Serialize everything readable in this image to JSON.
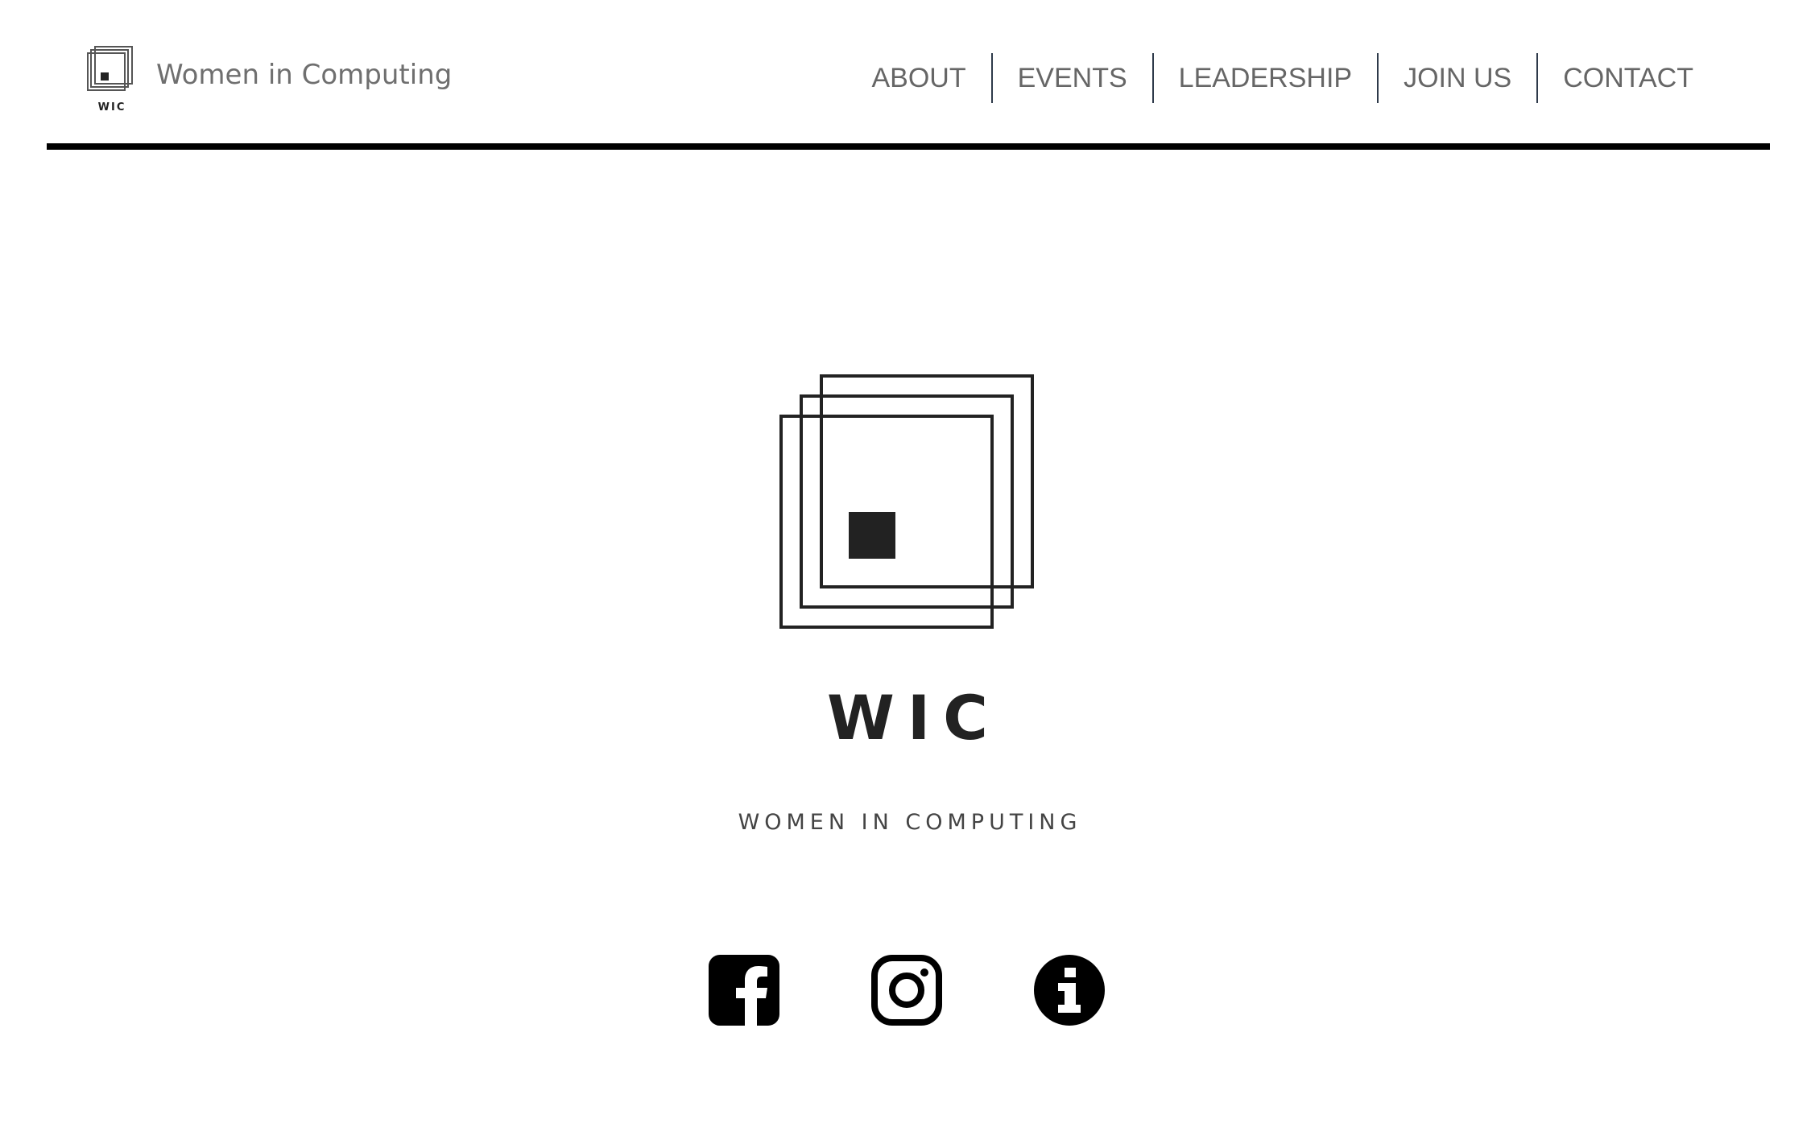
{
  "header": {
    "brand_name": "Women in Computing",
    "logo_text": "WIC",
    "nav": [
      {
        "label": "ABOUT"
      },
      {
        "label": "EVENTS"
      },
      {
        "label": "LEADERSHIP"
      },
      {
        "label": "JOIN US"
      },
      {
        "label": "CONTACT"
      }
    ]
  },
  "hero": {
    "title": "WIC",
    "subtitle": "WOMEN IN COMPUTING"
  },
  "social": [
    {
      "icon": "facebook-icon"
    },
    {
      "icon": "instagram-icon"
    },
    {
      "icon": "info-icon"
    }
  ],
  "colors": {
    "text_primary": "#222222",
    "nav_text": "#666666",
    "rule": "#000000",
    "background": "#ffffff"
  }
}
